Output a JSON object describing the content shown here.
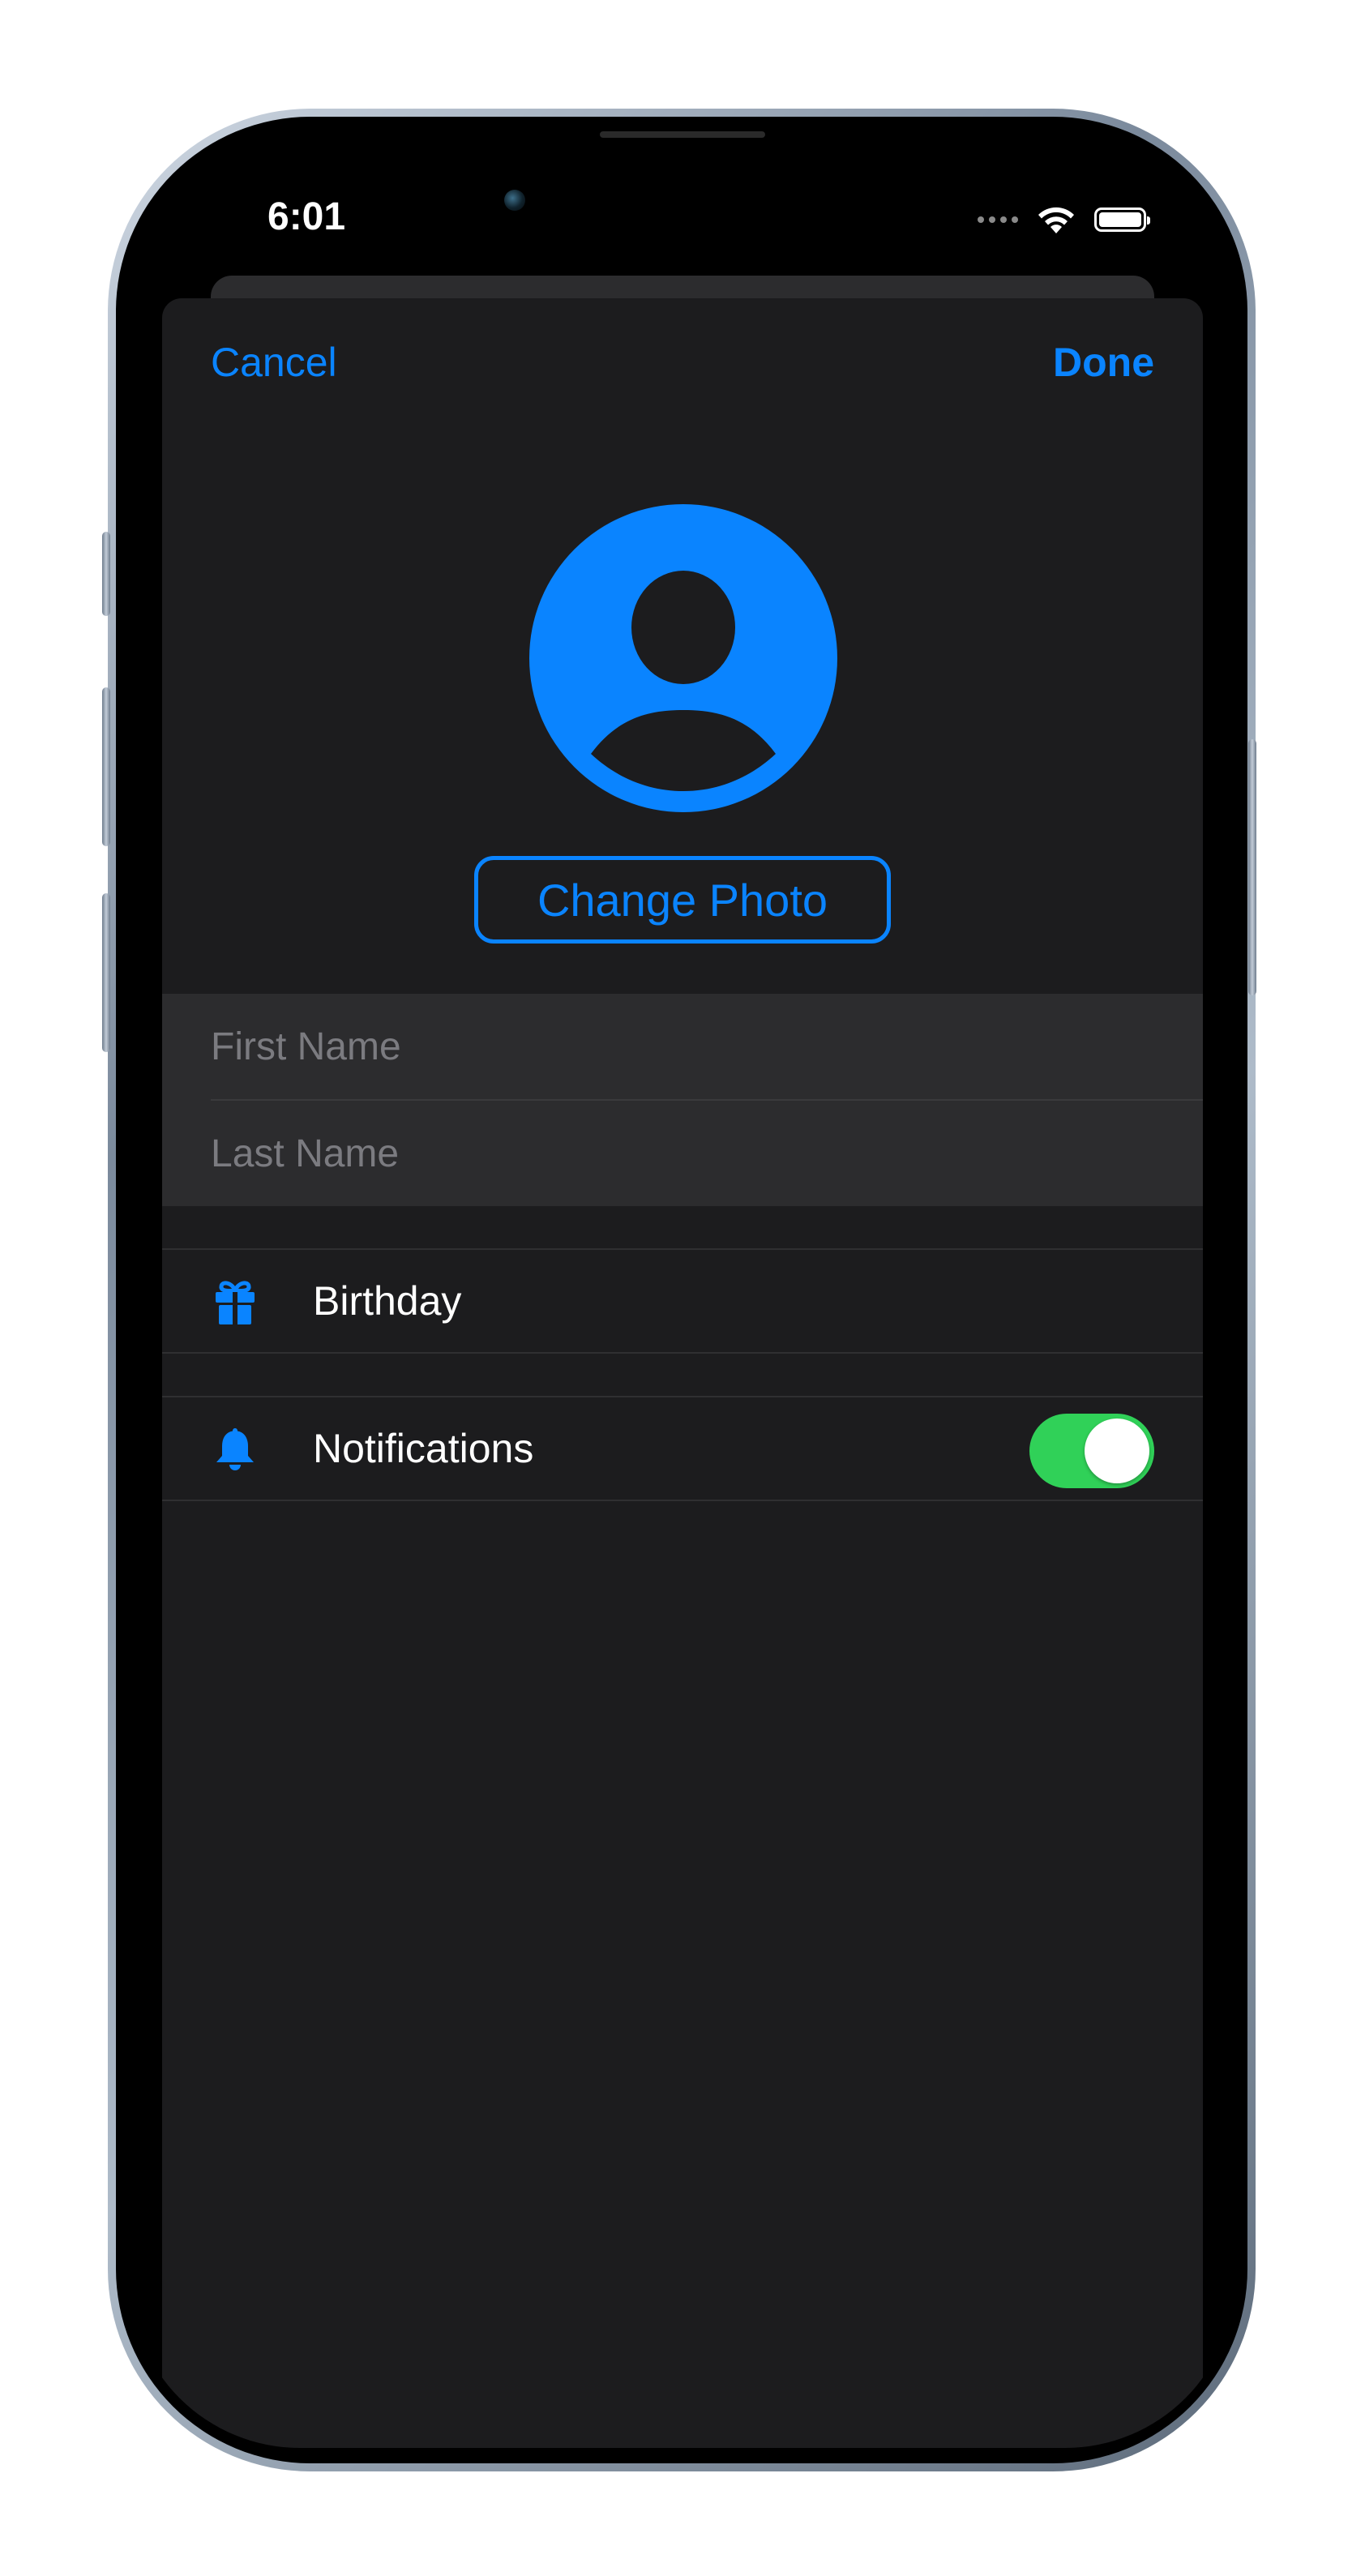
{
  "status_bar": {
    "time": "6:01"
  },
  "nav": {
    "cancel_label": "Cancel",
    "done_label": "Done"
  },
  "profile": {
    "avatar_icon": "person-circle-icon",
    "change_photo_label": "Change Photo"
  },
  "name_fields": {
    "first_name_placeholder": "First Name",
    "first_name_value": "",
    "last_name_placeholder": "Last Name",
    "last_name_value": ""
  },
  "settings": {
    "birthday": {
      "label": "Birthday",
      "icon": "gift-icon"
    },
    "notifications": {
      "label": "Notifications",
      "icon": "bell-icon",
      "enabled": true
    }
  },
  "colors": {
    "accent": "#0a84ff",
    "toggle_on": "#30d158",
    "background": "#1c1c1e",
    "group_background": "#2c2c2e"
  }
}
